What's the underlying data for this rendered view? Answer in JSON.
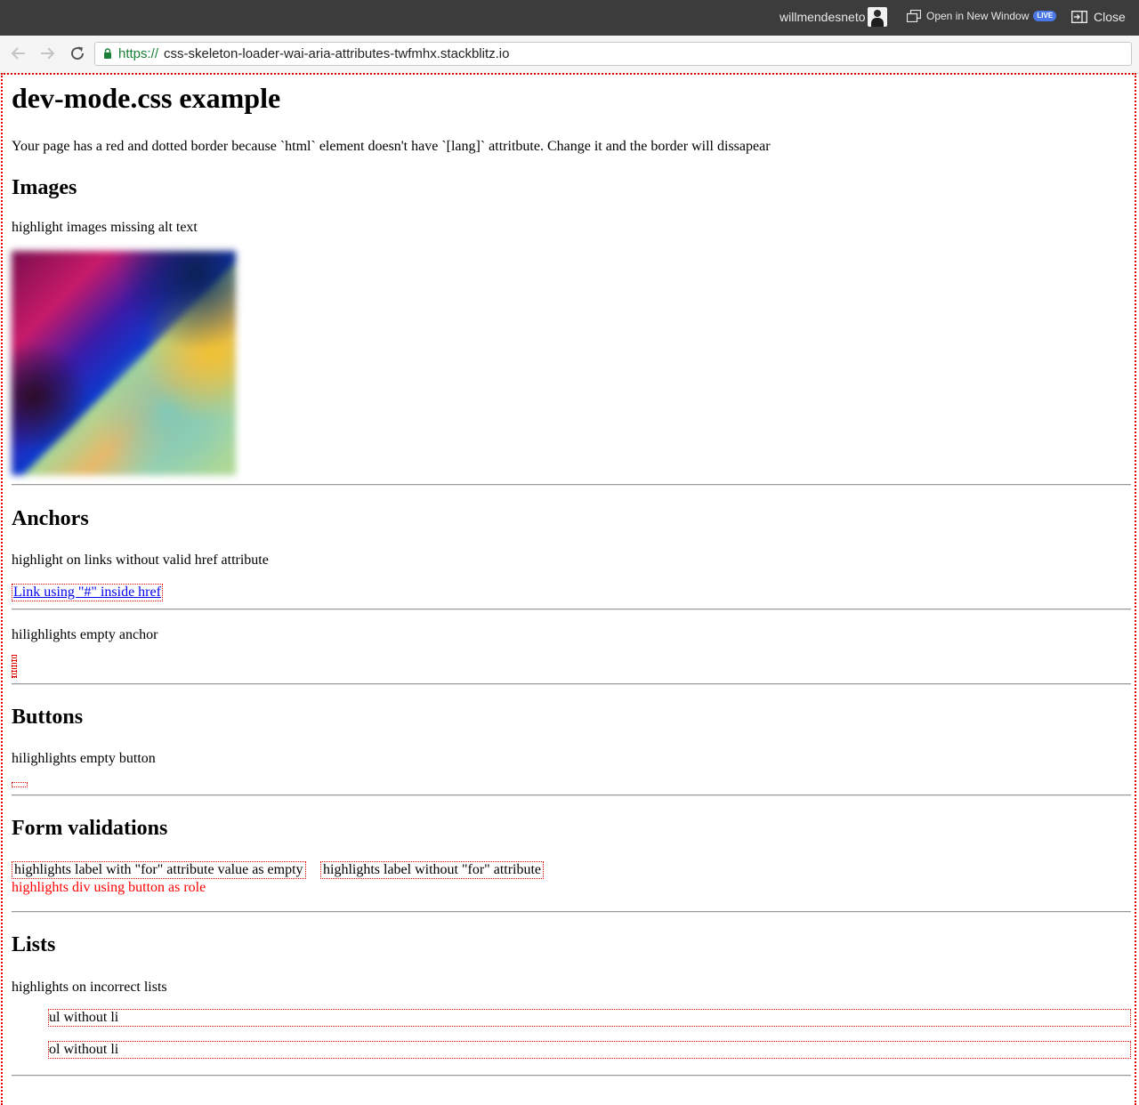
{
  "topbar": {
    "username": "willmendesneto",
    "open_in_new_window": "Open in New Window",
    "live_badge": "LIVE",
    "close_label": "Close"
  },
  "browser": {
    "url_scheme": "https://",
    "url_host": "css-skeleton-loader-wai-aria-attributes-twfmhx.stackblitz.io"
  },
  "page": {
    "title": "dev-mode.css example",
    "intro": "Your page has a red and dotted border because `html` element doesn't have `[lang]` attritbute. Change it and the border will dissapear",
    "images": {
      "heading": "Images",
      "desc": "highlight images missing alt text"
    },
    "anchors": {
      "heading": "Anchors",
      "desc": "highlight on links without valid href attribute",
      "link_text": "Link using \"#\" inside href",
      "empty_desc": "hilighlights empty anchor"
    },
    "buttons": {
      "heading": "Buttons",
      "desc": "hilighlights empty button"
    },
    "forms": {
      "heading": "Form validations",
      "label_empty_for": "highlights label with \"for\" attribute value as empty",
      "label_no_for": "highlights label without \"for\" attribute",
      "div_button_role": "highlights div using button as role"
    },
    "lists": {
      "heading": "Lists",
      "desc": "highlights on incorrect lists",
      "ul_text": "ul without li",
      "ol_text": "ol without li"
    }
  },
  "colors": {
    "highlight": "#e00000",
    "link": "#0000ee",
    "topbar_bg": "#3c3c3c",
    "live_badge": "#4a78e8"
  }
}
